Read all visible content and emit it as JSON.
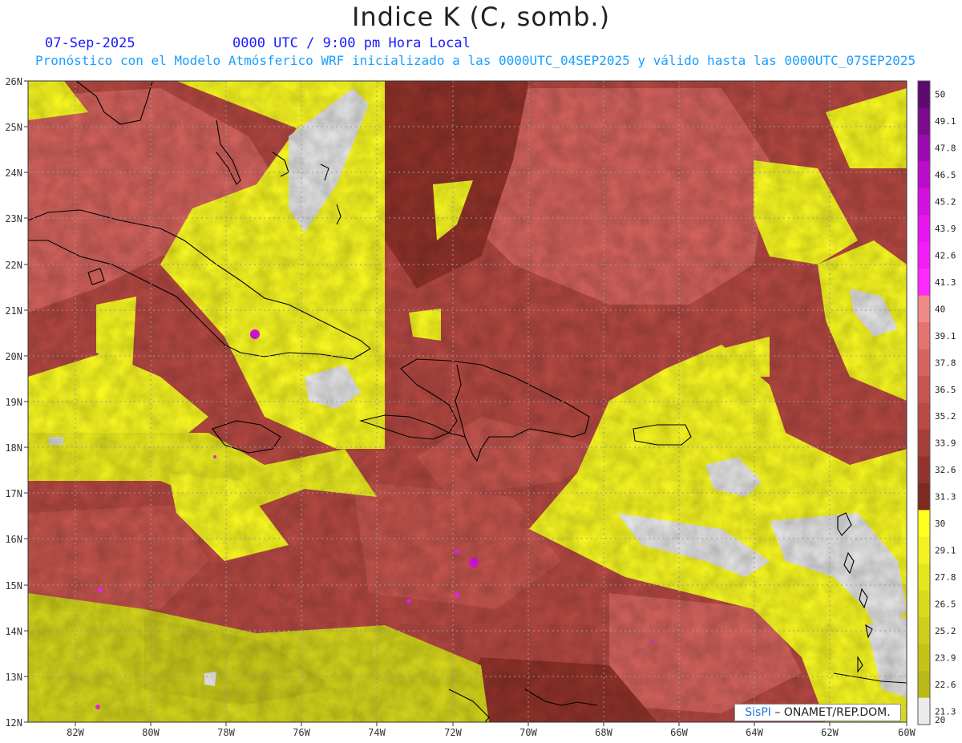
{
  "header": {
    "title": "Indice K (C, somb.)",
    "date": "07-Sep-2025",
    "time": "0000 UTC / 9:00 pm Hora Local",
    "subtitle": "Pronóstico con el Modelo Atmósferico WRF inicializado a las 0000UTC_04SEP2025 y válido hasta las  0000UTC_07SEP2025"
  },
  "map": {
    "lat_labels": [
      "26N",
      "25N",
      "24N",
      "23N",
      "22N",
      "21N",
      "20N",
      "19N",
      "18N",
      "17N",
      "16N",
      "15N",
      "14N",
      "13N",
      "12N"
    ],
    "lon_labels": [
      "82W",
      "80W",
      "78W",
      "76W",
      "74W",
      "72W",
      "70W",
      "68W",
      "66W",
      "64W",
      "62W",
      "60W"
    ],
    "lat_range": [
      12,
      26
    ],
    "lon_range": [
      -83.2,
      -60
    ]
  },
  "colorbar": {
    "labels": [
      "50",
      "49.1",
      "47.8",
      "46.5",
      "45.2",
      "43.9",
      "42.6",
      "41.3",
      "40",
      "39.1",
      "37.8",
      "36.5",
      "35.2",
      "33.9",
      "32.6",
      "31.3",
      "30",
      "29.1",
      "27.8",
      "26.5",
      "25.2",
      "23.9",
      "22.6",
      "21.3",
      "20"
    ],
    "colors": [
      "#5c0a6e",
      "#7a0a8e",
      "#9a0ab0",
      "#b90ccd",
      "#d410e0",
      "#e814ef",
      "#f41cf6",
      "#ff28ff",
      "#f08a86",
      "#e47470",
      "#d8645f",
      "#c8564f",
      "#b94a44",
      "#a63f38",
      "#93332b",
      "#7e2a1e",
      "#ffff22",
      "#f2f220",
      "#e6e61e",
      "#dada1c",
      "#cfcf1a",
      "#c4c418",
      "#b9b916",
      "#ebebeb"
    ]
  },
  "credit": {
    "brand": "SisPI",
    "text": " – ONAMET/REP.DOM."
  }
}
